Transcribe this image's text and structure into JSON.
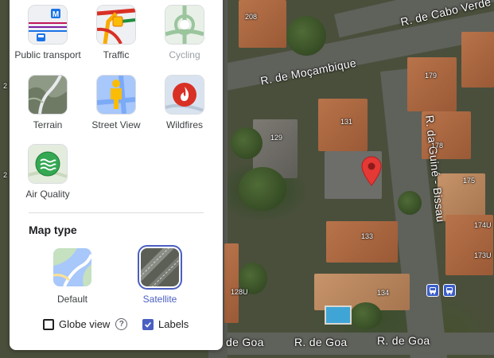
{
  "layers": [
    {
      "id": "public-transport",
      "label": "Public transport",
      "icon": "public-transport-icon",
      "enabled": true
    },
    {
      "id": "traffic",
      "label": "Traffic",
      "icon": "traffic-icon",
      "enabled": true
    },
    {
      "id": "cycling",
      "label": "Cycling",
      "icon": "cycling-icon",
      "enabled": false
    },
    {
      "id": "terrain",
      "label": "Terrain",
      "icon": "terrain-icon",
      "enabled": true
    },
    {
      "id": "street-view",
      "label": "Street View",
      "icon": "street-view-icon",
      "enabled": true
    },
    {
      "id": "wildfires",
      "label": "Wildfires",
      "icon": "wildfires-icon",
      "enabled": true
    },
    {
      "id": "air-quality",
      "label": "Air Quality",
      "icon": "air-quality-icon",
      "enabled": true
    }
  ],
  "map_type": {
    "title": "Map type",
    "options": [
      {
        "id": "default",
        "label": "Default",
        "selected": false
      },
      {
        "id": "satellite",
        "label": "Satellite",
        "selected": true
      }
    ]
  },
  "options": {
    "globe_view": {
      "label": "Globe view",
      "checked": false,
      "help_icon": "help-icon"
    },
    "labels": {
      "label": "Labels",
      "checked": true
    }
  },
  "map": {
    "streets": {
      "cabo_verde": "R. de Cabo Verde",
      "mocambique": "R. de Moçambique",
      "guine_bissau": "R. da Guiné - Bissau",
      "goa_1": "de Goa",
      "goa_2": "R. de Goa",
      "goa_3": "R. de Goa"
    },
    "building_numbers": {
      "n208": "208",
      "n179": "179",
      "n131": "131",
      "n129": "129",
      "n178": "178",
      "n175": "175",
      "n174u": "174U",
      "n173u": "173U",
      "n133": "133",
      "n128u": "128U",
      "n134": "134",
      "n2a": "2",
      "n2b": "2"
    },
    "accent_color": "#4a5fc1",
    "pin_color": "#e53935"
  }
}
